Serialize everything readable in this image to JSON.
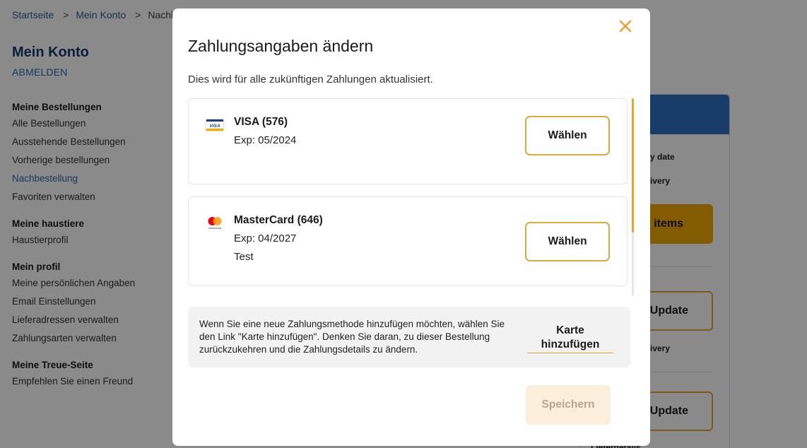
{
  "breadcrumb": {
    "items": [
      "Startseite",
      "Mein Konto",
      "Nachbestellung"
    ],
    "separator": ">"
  },
  "account": {
    "title": "Mein Konto",
    "logout_label": "ABMELDEN"
  },
  "side_nav": {
    "groups": [
      {
        "heading": "Meine Bestellungen",
        "items": [
          "Alle Bestellungen",
          "Ausstehende Bestellungen",
          "Vorherige bestellungen",
          "Nachbestellung",
          "Favoriten verwalten"
        ]
      },
      {
        "heading": "Meine haustiere",
        "items": [
          "Haustierprofil"
        ]
      },
      {
        "heading": "Mein profil",
        "items": [
          "Meine persönlichen Angaben",
          "Email Einstellungen",
          "Lieferadressen verwalten",
          "Zahlungsarten verwalten"
        ]
      },
      {
        "heading": "Meine Treue-Seite",
        "items": [
          "Empfehlen Sie einen Freund"
        ]
      }
    ],
    "active_item": "Nachbestellung"
  },
  "right_panel": {
    "date_text": "y date",
    "delivery_text_1": "ivery",
    "items_button": "e items",
    "update_button_1": "Update",
    "delivery_text_2": "ivery",
    "update_button_2": "Update",
    "bottom_text": "Lieferdetails"
  },
  "modal": {
    "title": "Zahlungsangaben ändern",
    "subtitle": "Dies wird für alle zukünftigen Zahlungen aktualisiert.",
    "close_icon": "close-icon",
    "cards": [
      {
        "brand": "VISA",
        "name": "VISA (576)",
        "exp": "Exp: 05/2024",
        "note": "",
        "select_label": "Wählen",
        "logo_icon": "visa-logo-icon",
        "logo_text": "VISA"
      },
      {
        "brand": "MasterCard",
        "name": "MasterCard (646)",
        "exp": "Exp: 04/2027",
        "note": "Test",
        "select_label": "Wählen",
        "logo_icon": "mastercard-logo-icon",
        "logo_text": "mastercard"
      }
    ],
    "info": {
      "text": "Wenn Sie eine neue Zahlungsmethode hinzufügen möchten, wählen Sie den Link \"Karte hinzufügen\". Denken Sie daran, zu dieser Bestellung zurückzukehren und die Zahlungsdetails zu ändern.",
      "add_card_label": "Karte hinzufügen"
    },
    "save_label": "Speichern"
  },
  "colors": {
    "accent": "#e8a433",
    "brand_blue": "#2f72c2",
    "link_blue": "#2e6bb0",
    "overlay": "rgba(0,0,0,0.46)",
    "save_disabled_bg": "#fbeedb"
  }
}
